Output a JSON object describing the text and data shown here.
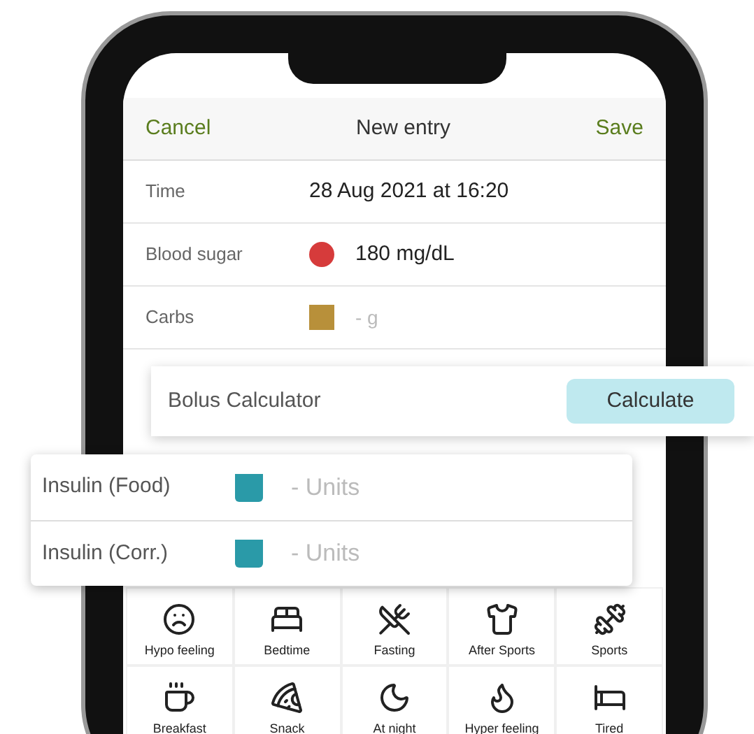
{
  "header": {
    "cancel": "Cancel",
    "title": "New entry",
    "save": "Save"
  },
  "rows": [
    {
      "kind": "text",
      "label": "Time",
      "value": "28 Aug 2021 at 16:20"
    },
    {
      "kind": "dot",
      "label": "Blood sugar",
      "value": "180 mg/dL",
      "color": "#d63b3b"
    },
    {
      "kind": "square",
      "label": "Carbs",
      "placeholder": "- g",
      "color": "#b8903a"
    }
  ],
  "bolus": {
    "label": "Bolus Calculator",
    "button": "Calculate"
  },
  "insulin": [
    {
      "label": "Insulin (Food)",
      "placeholder": "- Units",
      "color": "#2a9aa8"
    },
    {
      "label": "Insulin (Corr.)",
      "placeholder": "- Units",
      "color": "#2a9aa8"
    }
  ],
  "tags": [
    {
      "label": "Hypo feeling"
    },
    {
      "label": "Bedtime"
    },
    {
      "label": "Fasting"
    },
    {
      "label": "After Sports"
    },
    {
      "label": "Sports"
    },
    {
      "label": "Breakfast"
    },
    {
      "label": "Snack"
    },
    {
      "label": "At night"
    },
    {
      "label": "Hyper feeling"
    },
    {
      "label": "Tired"
    }
  ]
}
